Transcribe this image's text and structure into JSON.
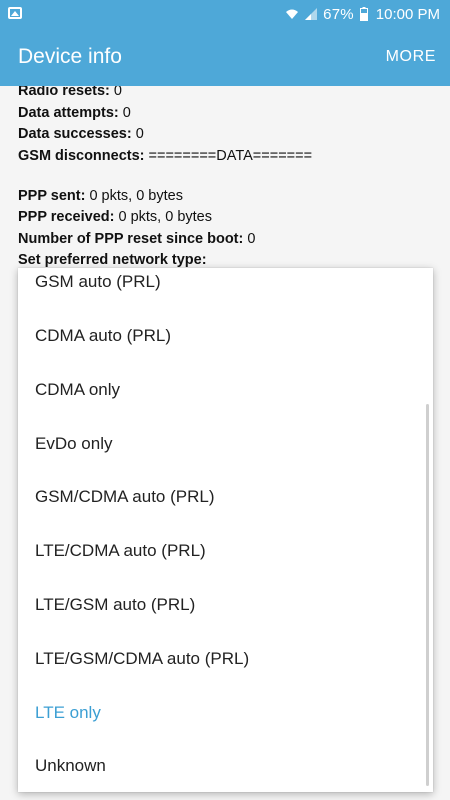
{
  "status_bar": {
    "battery": "67%",
    "time": "10:00 PM",
    "icons": [
      "gallery-icon",
      "wifi-icon",
      "signal-icon",
      "battery-icon"
    ]
  },
  "app_bar": {
    "title": "Device info",
    "more": "MORE"
  },
  "info": {
    "radio_resets_label": "Radio resets:",
    "radio_resets_value": "0",
    "data_attempts_label": "Data attempts:",
    "data_attempts_value": "0",
    "data_successes_label": "Data successes:",
    "data_successes_value": "0",
    "gsm_disconnects_label": "GSM disconnects:",
    "gsm_disconnects_value": "========DATA=======",
    "ppp_sent_label": "PPP sent:",
    "ppp_sent_value": "0 pkts, 0 bytes",
    "ppp_received_label": "PPP received:",
    "ppp_received_value": "0 pkts, 0 bytes",
    "ppp_reset_label": "Number of PPP reset since boot:",
    "ppp_reset_value": "0",
    "network_type_label": "Set preferred network type:"
  },
  "network_options": {
    "items": [
      "GSM auto (PRL)",
      "CDMA auto (PRL)",
      "CDMA only",
      "EvDo only",
      "GSM/CDMA auto (PRL)",
      "LTE/CDMA auto (PRL)",
      "LTE/GSM auto (PRL)",
      "LTE/GSM/CDMA auto (PRL)",
      "LTE only",
      "Unknown"
    ],
    "selected": "LTE only",
    "accent_color": "#3c9fd3"
  },
  "colors": {
    "app_bar": "#4ea8d8",
    "background": "#f5f5f5"
  }
}
